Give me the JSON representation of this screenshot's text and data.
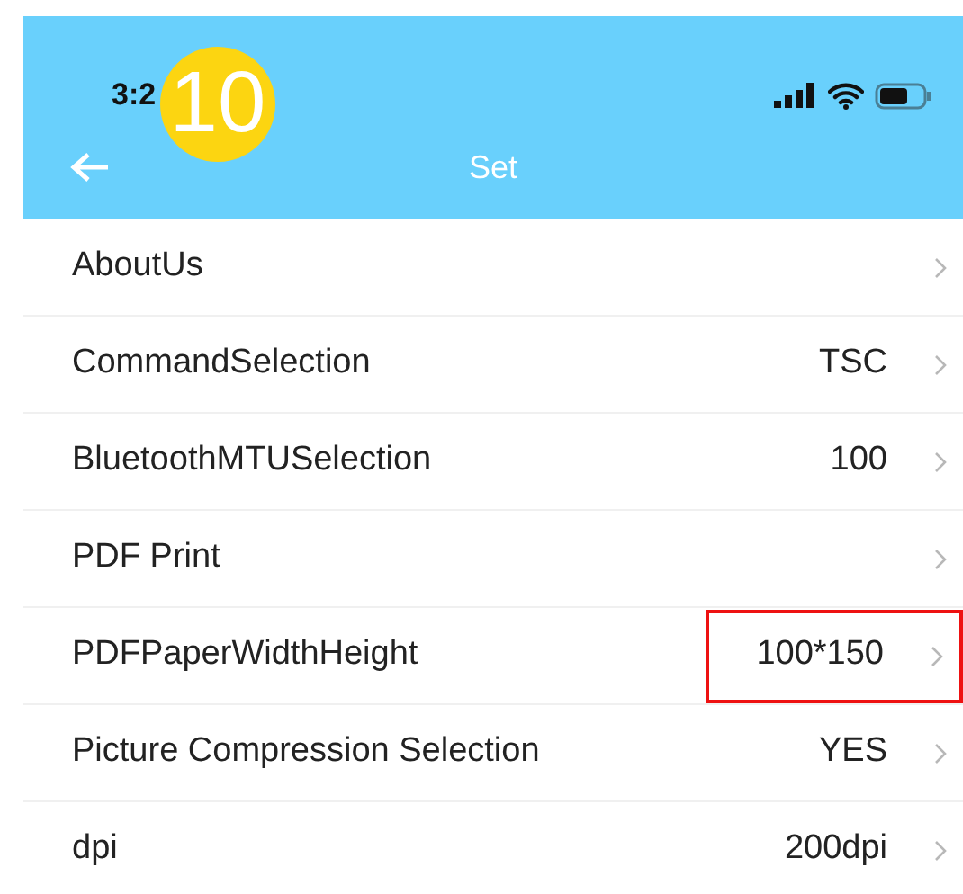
{
  "status_bar": {
    "time": "3:2"
  },
  "annotation_badge": {
    "text": "10"
  },
  "header": {
    "title": "Set"
  },
  "rows": [
    {
      "label": "AboutUs",
      "highlighted": false
    },
    {
      "label": "CommandSelection",
      "value": "TSC",
      "highlighted": false
    },
    {
      "label": "BluetoothMTUSelection",
      "value": "100",
      "highlighted": false
    },
    {
      "label": "PDF Print",
      "highlighted": false
    },
    {
      "label": "PDFPaperWidthHeight",
      "value": "100*150",
      "highlighted": true
    },
    {
      "label": "Picture Compression Selection",
      "value": "YES",
      "highlighted": false
    },
    {
      "label": "dpi",
      "value": "200dpi",
      "highlighted": false
    }
  ]
}
